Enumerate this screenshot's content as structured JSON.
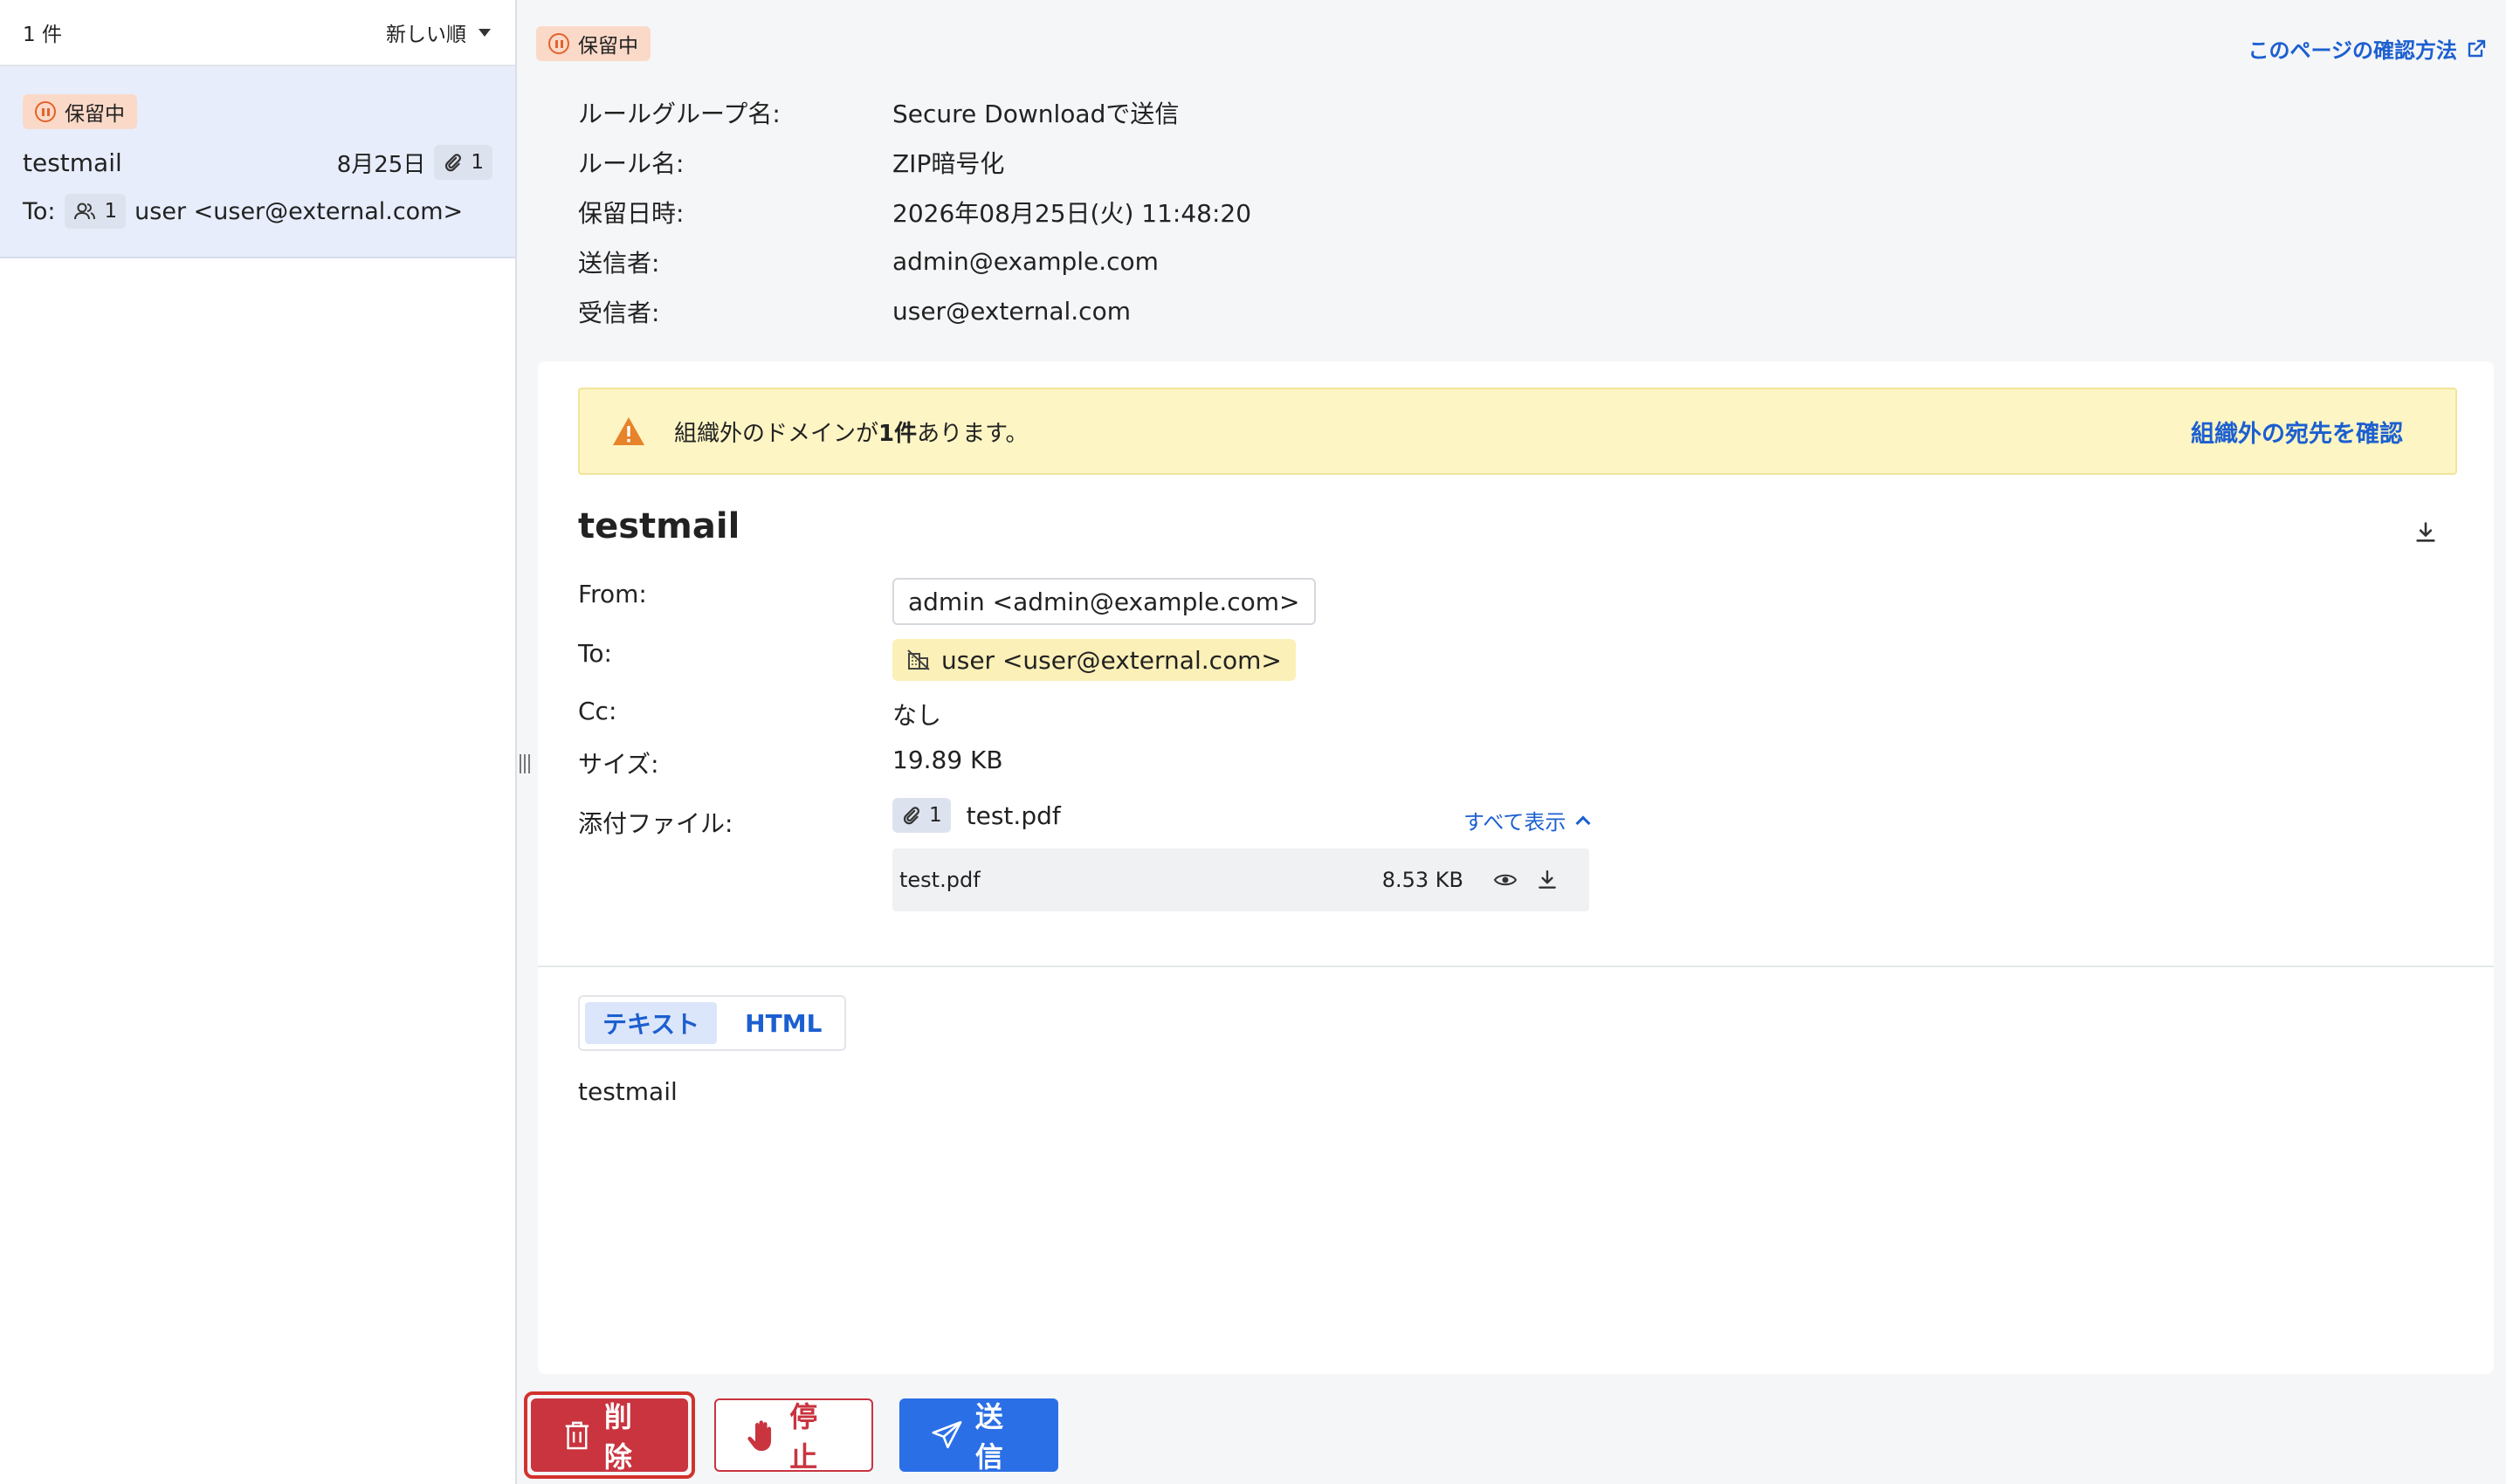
{
  "list": {
    "count": "1 件",
    "sort_label": "新しい順",
    "item": {
      "status": "保留中",
      "subject": "testmail",
      "date": "8月25日",
      "attachments": "1",
      "to_prefix": "To:",
      "recipient_count": "1",
      "recipient": "user <user@external.com>"
    }
  },
  "detail": {
    "status": "保留中",
    "help_link": "このページの確認方法",
    "meta": [
      {
        "key": "ルールグループ名:",
        "value": "Secure Downloadで送信"
      },
      {
        "key": "ルール名:",
        "value": "ZIP暗号化"
      },
      {
        "key": "保留日時:",
        "value": "2026年08月25日(火) 11:48:20"
      },
      {
        "key": "送信者:",
        "value": "admin@example.com"
      },
      {
        "key": "受信者:",
        "value": "user@external.com"
      }
    ],
    "warning": {
      "text_before": "組織外のドメインが",
      "text_bold": "1件",
      "text_after": "あります。",
      "link": "組織外の宛先を確認"
    },
    "mail": {
      "subject": "testmail",
      "from_label": "From:",
      "from_value": "admin <admin@example.com>",
      "to_label": "To:",
      "to_value": "user <user@external.com>",
      "cc_label": "Cc:",
      "cc_value": "なし",
      "size_label": "サイズ:",
      "size_value": "19.89 KB",
      "attach_label": "添付ファイル:",
      "attach_count": "1",
      "attach_name": "test.pdf",
      "show_all": "すべて表示",
      "attachments": [
        {
          "name": "test.pdf",
          "size": "8.53 KB"
        }
      ]
    },
    "tabs": [
      "テキスト",
      "HTML"
    ],
    "body": "testmail"
  },
  "actions": {
    "delete": "削除",
    "stop": "停止",
    "send": "送信"
  },
  "colors": {
    "accent": "#2b6fe6",
    "danger": "#c9343f",
    "hold_badge": "#fbd9c8",
    "warning_bg": "#fdf5c4",
    "link": "#1c5fd0"
  }
}
